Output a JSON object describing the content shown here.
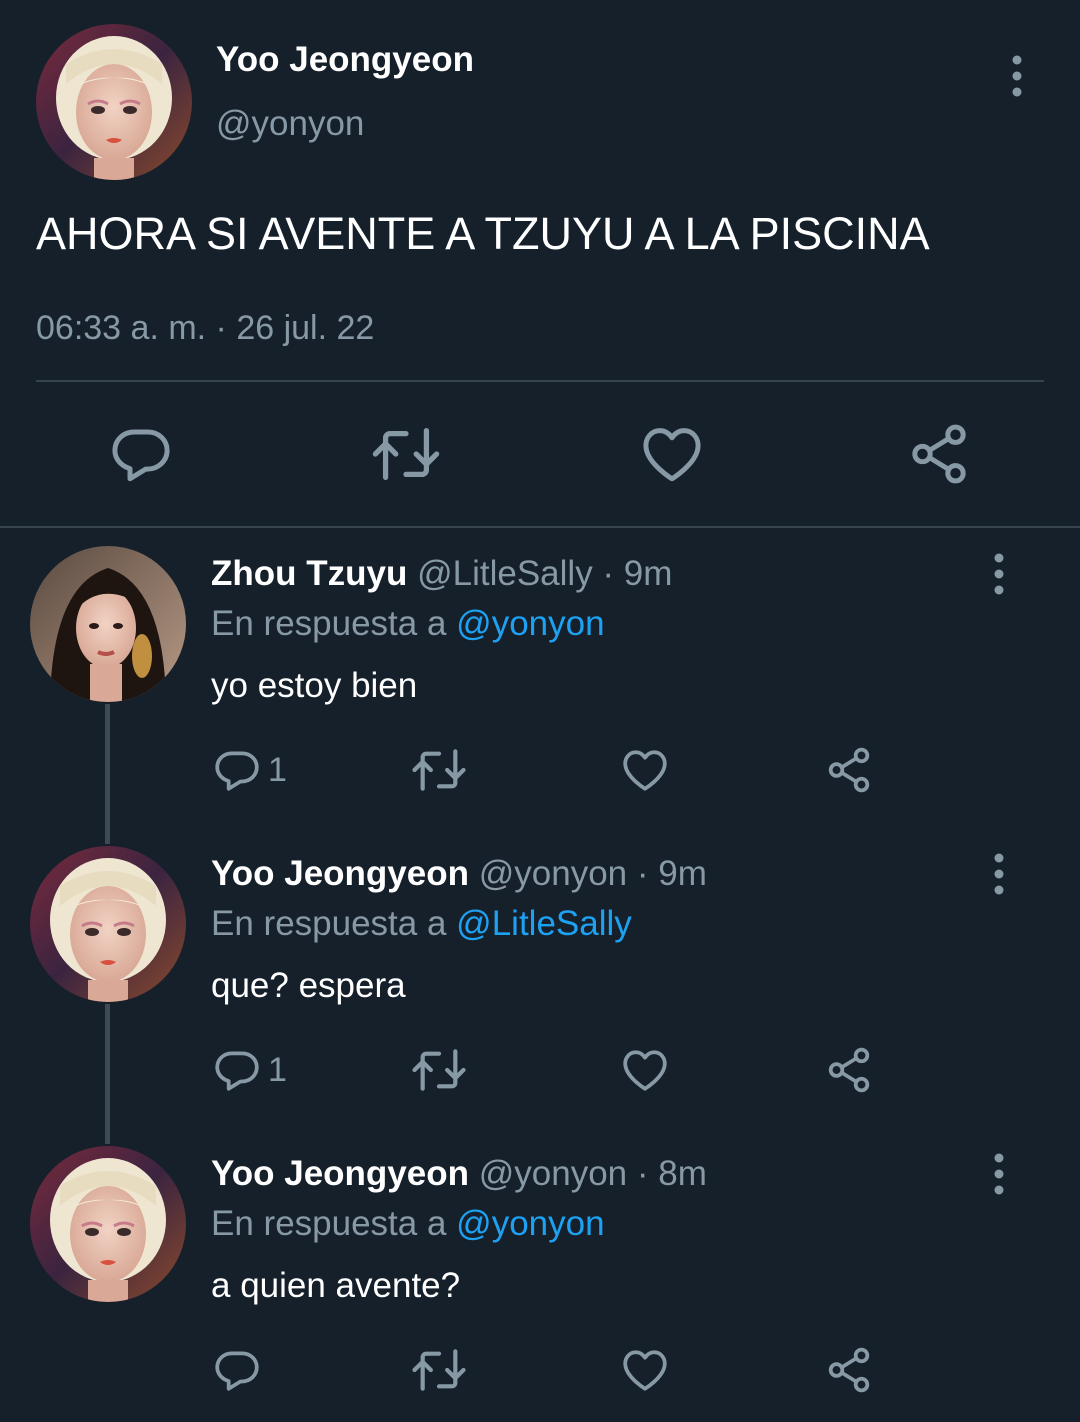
{
  "main_tweet": {
    "name": "Yoo Jeongyeon",
    "handle": "@yonyon",
    "text": "AHORA SI AVENTE A TZUYU A LA PISCINA",
    "timestamp": "06:33 a. m. · 26 jul. 22",
    "actions": [
      "reply-icon",
      "retweet-icon",
      "like-icon",
      "share-icon"
    ]
  },
  "replies": [
    {
      "name": "Zhou Tzuyu",
      "handle_time": "@LitleSally · 9m",
      "reply_prefix": "En respuesta a",
      "reply_to": "@yonyon",
      "text": "yo estoy bien",
      "reply_count": "1"
    },
    {
      "name": "Yoo Jeongyeon",
      "handle_time": "@yonyon · 9m",
      "reply_prefix": "En respuesta a",
      "reply_to": "@LitleSally",
      "text": "que? espera",
      "reply_count": "1"
    },
    {
      "name": "Yoo Jeongyeon",
      "handle_time": "@yonyon · 8m",
      "reply_prefix": "En respuesta a",
      "reply_to": "@yonyon",
      "text": "a quien avente?",
      "reply_count": ""
    }
  ],
  "colors": {
    "background": "#15202b",
    "secondary_text": "#8899a6",
    "mention": "#1da1f2",
    "divider": "#38444d"
  }
}
